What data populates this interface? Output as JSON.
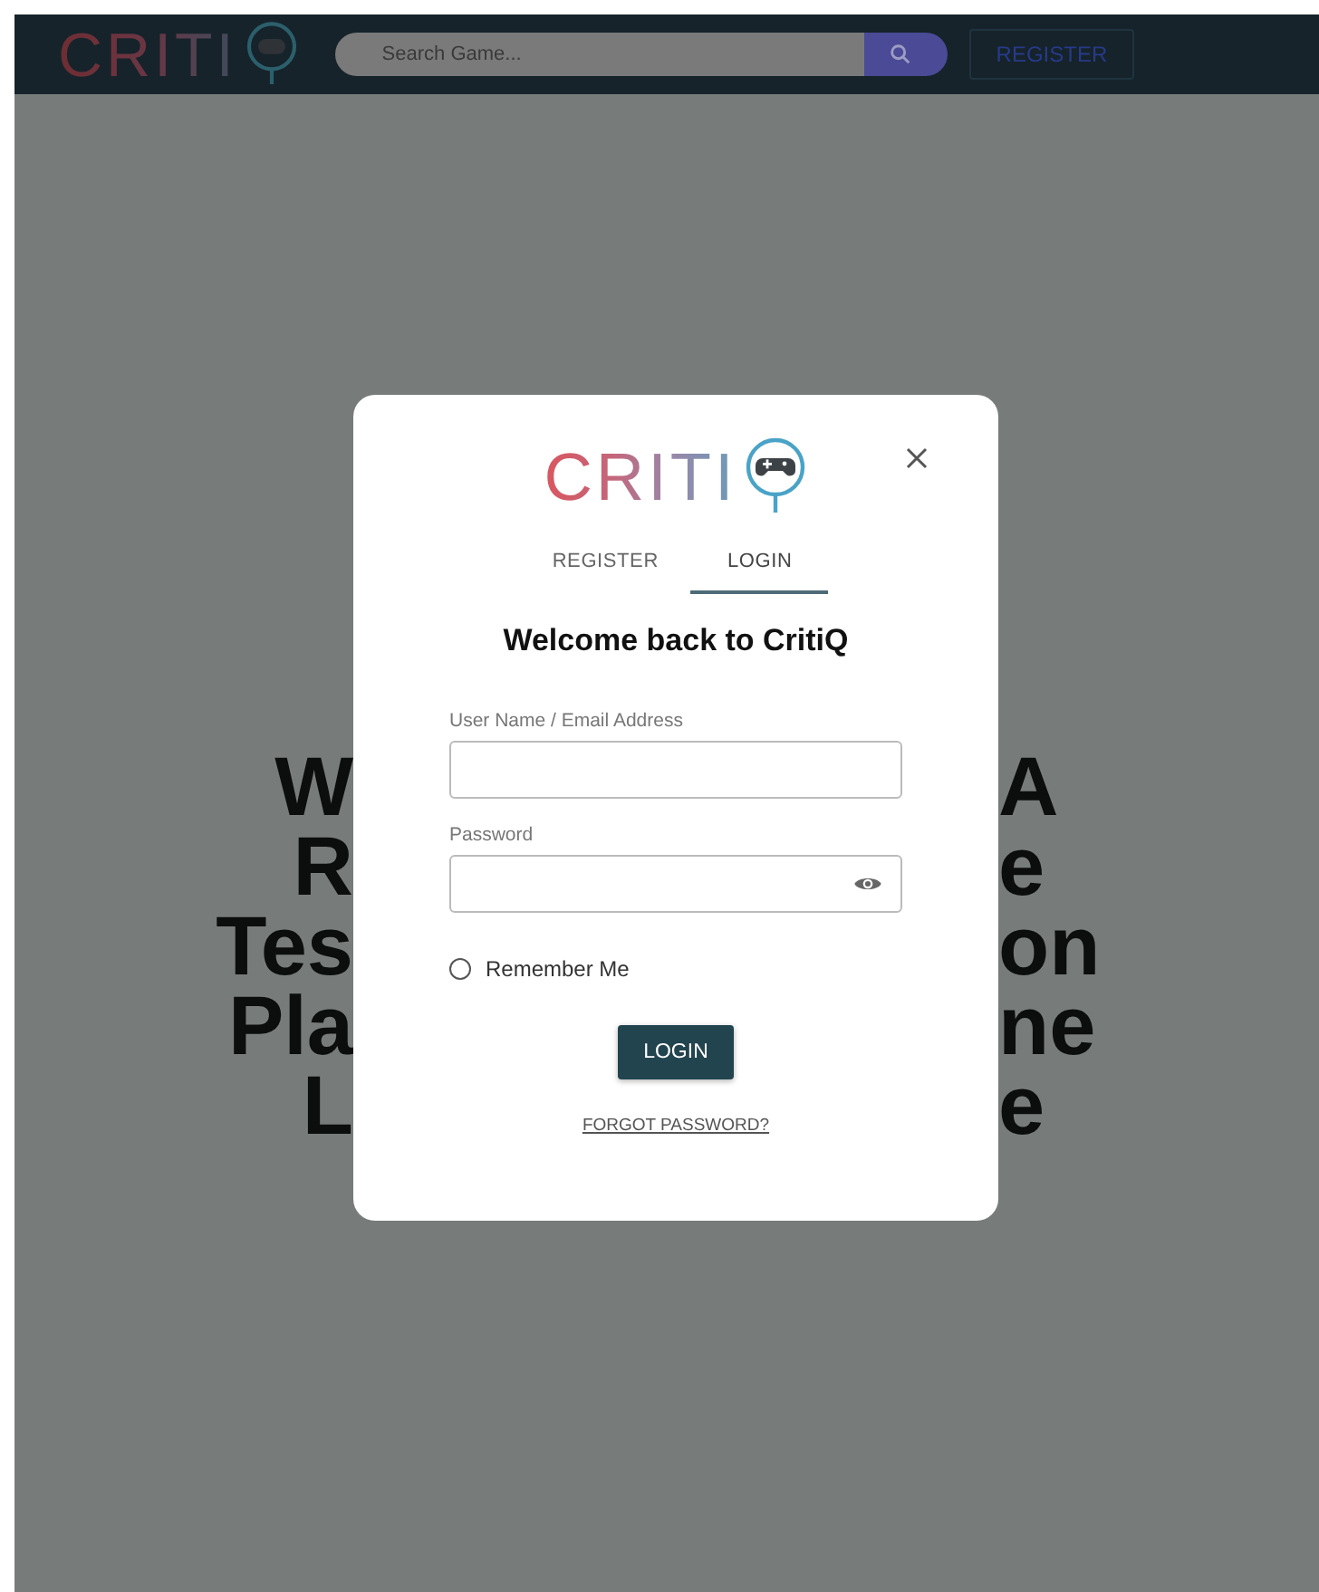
{
  "header": {
    "logo_text": "CRITI",
    "search": {
      "placeholder": "Search Game..."
    },
    "register_button": "REGISTER"
  },
  "background_heading": [
    {
      "left": "W",
      "right": "A"
    },
    {
      "left": "R",
      "right": "e"
    },
    {
      "left": "Tes",
      "right": "on"
    },
    {
      "left": "Pla",
      "right": "ne"
    },
    {
      "left": "L",
      "right": "e"
    }
  ],
  "modal": {
    "logo_text": "CRITI",
    "tabs": [
      {
        "label": "REGISTER",
        "selected": false
      },
      {
        "label": "LOGIN",
        "selected": true
      }
    ],
    "title": "Welcome back to CritiQ",
    "fields": [
      {
        "label": "User Name / Email Address",
        "kind": "text"
      },
      {
        "label": "Password",
        "kind": "password"
      }
    ],
    "remember": {
      "label": "Remember Me",
      "checked": false
    },
    "login_button": "LOGIN",
    "forgot_link": "FORGOT PASSWORD?"
  }
}
